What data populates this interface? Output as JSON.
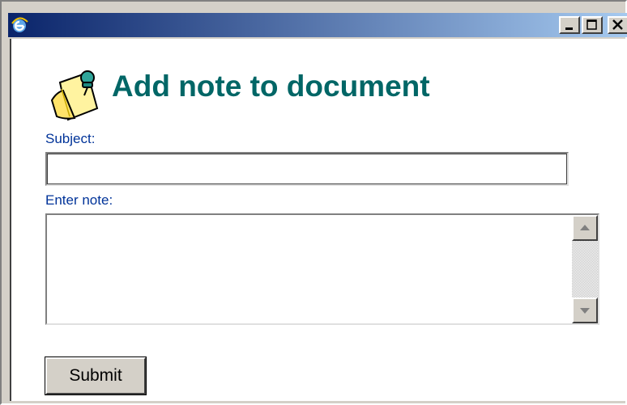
{
  "window": {
    "title": "",
    "icon": "ie-icon",
    "controls": [
      "minimize-icon",
      "maximize-icon",
      "close-icon"
    ]
  },
  "form": {
    "title": "Add note to document",
    "title_icon": "note-pin-icon",
    "subject_label": "Subject:",
    "subject_value": "",
    "note_label": "Enter note:",
    "note_value": "",
    "submit_label": "Submit"
  },
  "colors": {
    "title": "#006666",
    "labels": "#003399",
    "titlebar_start": "#0a246a",
    "titlebar_end": "#a6caf0"
  }
}
